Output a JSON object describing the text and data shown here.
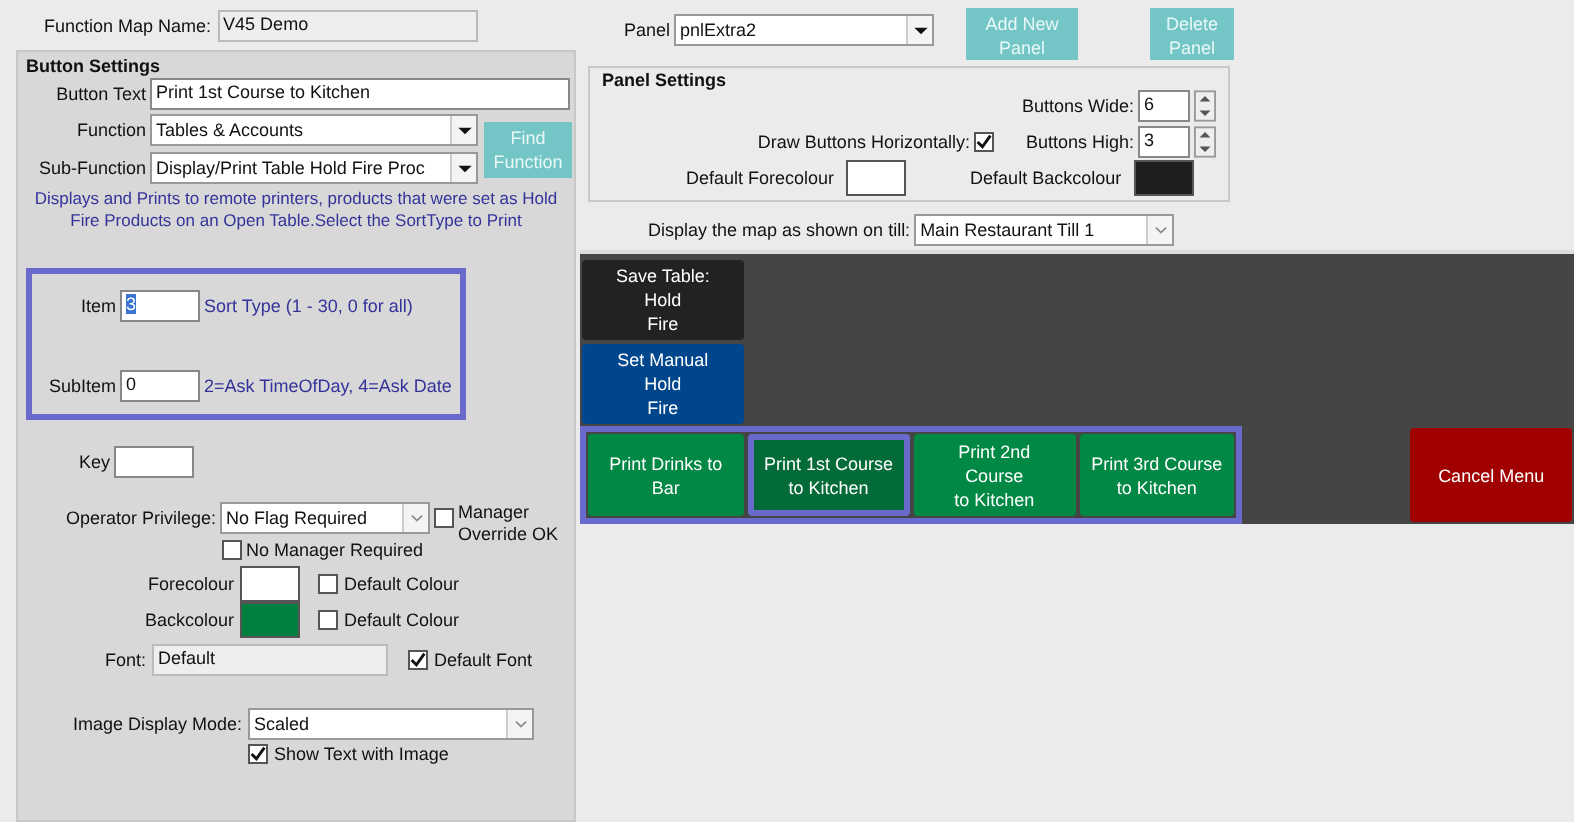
{
  "map_name": {
    "label": "Function Map Name:",
    "value": "V45 Demo"
  },
  "button_settings": {
    "title": "Button Settings",
    "button_text": {
      "label": "Button Text",
      "value": "Print 1st Course to Kitchen"
    },
    "function": {
      "label": "Function",
      "value": "Tables & Accounts"
    },
    "sub_function": {
      "label": "Sub-Function",
      "value": "Display/Print Table Hold Fire Proc"
    },
    "find_button": "Find Function",
    "description": "Displays and Prints to remote printers, products that were set as Hold Fire Products on an Open Table.Select the SortType to Print",
    "item_group_highlighted": true,
    "item": {
      "label": "Item",
      "value": "3",
      "hint": "Sort Type (1 - 30, 0 for all)"
    },
    "subitem": {
      "label": "SubItem",
      "value": "0",
      "hint": "2=Ask TimeOfDay, 4=Ask Date"
    },
    "key": {
      "label": "Key"
    },
    "operator_privilege": {
      "label": "Operator Privilege:",
      "value": "No Flag Required"
    },
    "manager_override": {
      "label": "Manager Override OK",
      "checked": false
    },
    "no_manager": {
      "label": "No Manager Required",
      "checked": false
    },
    "colours": [
      {
        "label": "Forecolour",
        "color": "#ffffff",
        "default_label": "Default Colour",
        "default_checked": false
      },
      {
        "label": "Backcolour",
        "color": "#008040",
        "default_label": "Default Colour",
        "default_checked": false
      }
    ],
    "font": {
      "label": "Font:",
      "value": "Default",
      "default_label": "Default Font",
      "default_checked": true
    },
    "image_mode": {
      "label": "Image Display Mode:",
      "value": "Scaled"
    },
    "show_text": {
      "label": "Show Text with Image",
      "checked": true
    }
  },
  "panel": {
    "label": "Panel",
    "value": "pnlExtra2"
  },
  "panel_buttons": [
    "Add New Panel",
    "Delete Panel"
  ],
  "panel_settings": {
    "title": "Panel Settings",
    "buttons_wide": {
      "label": "Buttons Wide:",
      "value": "6"
    },
    "buttons_high": {
      "label": "Buttons High:",
      "value": "3"
    },
    "draw_horizontally": {
      "label": "Draw Buttons Horizontally:",
      "checked": true
    },
    "default_forecolour": {
      "label": "Default Forecolour",
      "color": "#ffffff"
    },
    "default_backcolour": {
      "label": "Default Backcolour",
      "color": "#1e1e1e"
    }
  },
  "display_map": {
    "label": "Display the map as shown on till:",
    "value": "Main Restaurant Till 1"
  },
  "grid": {
    "rows": [
      {
        "cells": [
          {
            "kind": "button",
            "text": "Save Table:\nHold\nFire",
            "color": "#222222",
            "selected": false,
            "highlighted": false
          },
          {
            "kind": "empty"
          },
          {
            "kind": "empty"
          },
          {
            "kind": "empty"
          },
          {
            "kind": "empty"
          },
          {
            "kind": "empty"
          }
        ]
      },
      {
        "cells": [
          {
            "kind": "button",
            "text": "Set Manual\nHold\nFire",
            "color": "#00468c",
            "selected": false,
            "highlighted": false
          },
          {
            "kind": "empty"
          },
          {
            "kind": "empty"
          },
          {
            "kind": "empty"
          },
          {
            "kind": "empty"
          },
          {
            "kind": "empty"
          }
        ]
      },
      {
        "cells": [
          {
            "kind": "button",
            "text": "Print Drinks to\nBar",
            "color": "#008844",
            "selected": false,
            "highlighted": true
          },
          {
            "kind": "button",
            "text": "Print 1st Course\nto Kitchen",
            "color": "#036b37",
            "selected": true,
            "highlighted": true
          },
          {
            "kind": "button",
            "text": "Print 2nd\nCourse\nto Kitchen",
            "color": "#008844",
            "selected": false,
            "highlighted": true
          },
          {
            "kind": "button",
            "text": "Print 3rd Course\nto Kitchen",
            "color": "#008844",
            "selected": false,
            "highlighted": true
          },
          {
            "kind": "empty"
          },
          {
            "kind": "button",
            "text": "Cancel Menu",
            "color": "#a00000",
            "selected": false,
            "highlighted": false
          }
        ]
      }
    ]
  }
}
